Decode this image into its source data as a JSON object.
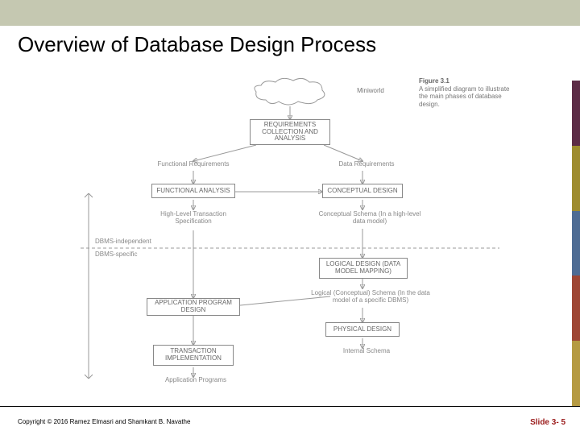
{
  "title": "Overview of Database Design Process",
  "footer": {
    "copyright": "Copyright © 2016 Ramez Elmasri and Shamkant B. Navathe",
    "slide": "Slide 3- 5"
  },
  "diagram": {
    "caption_label": "Figure 3.1",
    "caption_text": "A simplified diagram to illustrate the main phases of database design.",
    "miniworld": "Miniworld",
    "requirements_box": "REQUIREMENTS COLLECTION AND ANALYSIS",
    "functional_req": "Functional Requirements",
    "data_req": "Data Requirements",
    "functional_analysis": "FUNCTIONAL ANALYSIS",
    "conceptual_design": "CONCEPTUAL DESIGN",
    "highlevel_trans": "High-Level Transaction Specification",
    "conceptual_schema": "Conceptual Schema (In a high-level data model)",
    "dbms_independent": "DBMS-independent",
    "dbms_specific": "DBMS-specific",
    "logical_design": "LOGICAL DESIGN (DATA MODEL MAPPING)",
    "logical_schema": "Logical (Conceptual) Schema (In the data model of a specific DBMS)",
    "app_program_design": "APPLICATION PROGRAM DESIGN",
    "physical_design": "PHYSICAL DESIGN",
    "internal_schema": "Internal Schema",
    "transaction_impl": "TRANSACTION IMPLEMENTATION",
    "application_programs": "Application Programs"
  }
}
